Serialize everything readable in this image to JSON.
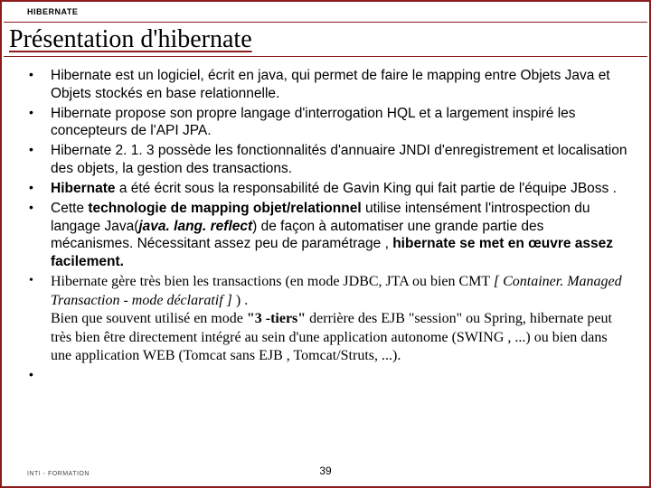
{
  "header": {
    "label": "HIBERNATE",
    "title": "Présentation d'hibernate"
  },
  "bullets": {
    "b1": " Hibernate est un logiciel, écrit en java, qui permet de faire le mapping entre Objets Java et Objets stockés en base relationnelle.",
    "b2": "Hibernate propose son propre langage d'interrogation HQL et a largement inspiré les concepteurs de l'API JPA.",
    "b3": "Hibernate 2. 1. 3 possède les fonctionnalités d'annuaire JNDI d'enregistrement et localisation des objets, la gestion des transactions.",
    "b4_lead": " Hibernate ",
    "b4_rest": "a été écrit sous la responsabilité de Gavin King qui fait partie de l'équipe JBoss .",
    "b5_a": "Cette ",
    "b5_b": "technologie de mapping objet/relationnel",
    "b5_c": " utilise intensément l'introspection du langage Java(",
    "b5_d": "java. lang. reflect",
    "b5_e": ") de façon à automatiser une grande partie des mécanismes. Nécessitant assez peu de paramétrage , ",
    "b5_f": "hibernate se met en œuvre assez facilement.",
    "b6_a": "Hibernate gère très bien les transactions (en mode JDBC, JTA ou bien CMT ",
    "b6_b": "[ Container. Managed Transaction - mode déclaratif ]",
    "b6_c": " ) .",
    "b6_d": "Bien que souvent utilisé en mode ",
    "b6_e": "\"3 -tiers\"",
    "b6_f": " derrière des EJB \"session\" ou Spring, hibernate peut très bien être directement intégré au sein d'une application autonome (SWING , ...) ou bien dans une application WEB (Tomcat sans EJB , Tomcat/Struts, ...)."
  },
  "footer": {
    "left": "INTI - FORMATION",
    "page": "39"
  }
}
